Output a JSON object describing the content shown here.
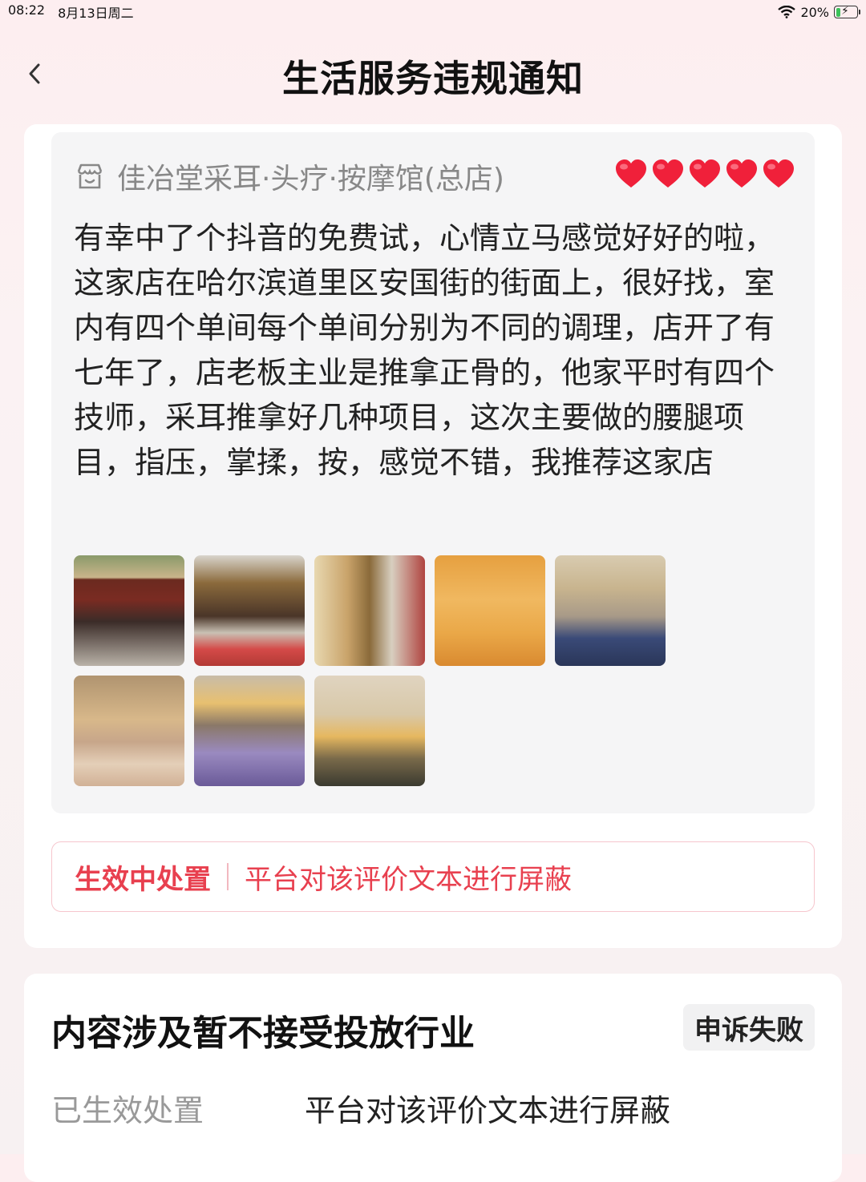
{
  "status_bar": {
    "time": "08:22",
    "date": "8月13日周二",
    "battery": "20%",
    "battery_level": 0.2
  },
  "header": {
    "title": "生活服务违规通知"
  },
  "review": {
    "shop_name": "佳冶堂采耳·头疗·按摩馆(总店)",
    "rating_hearts": 5,
    "text": "有幸中了个抖音的免费试，心情立马感觉好好的啦，这家店在哈尔滨道里区安国街的街面上，很好找，室内有四个单间每个单间分别为不同的调理，店开了有七年了，店老板主业是推拿正骨的，他家平时有四个技师，采耳推拿好几种项目，这次主要做的腰腿项目，指压，掌揉，按，感觉不错，我推荐这家店",
    "photo_count": 8
  },
  "action": {
    "label": "生效中处置",
    "value": "平台对该评价文本进行屏蔽"
  },
  "violation": {
    "reason": "内容涉及暂不接受投放行业",
    "appeal_status": "申诉失败",
    "applied_label": "已生效处置",
    "applied_value": "平台对该评价文本进行屏蔽"
  },
  "colors": {
    "accent": "#e8404f",
    "heart": "#f0203a"
  }
}
